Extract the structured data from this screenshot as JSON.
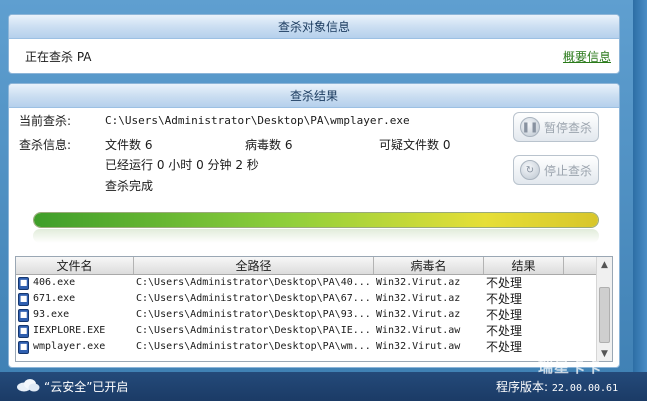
{
  "panel1": {
    "title": "查杀对象信息",
    "status_text": "正在查杀 PA",
    "summary_link": "概要信息"
  },
  "panel2": {
    "title": "查杀结果",
    "current_scan_label": "当前查杀:",
    "current_scan_value": "C:\\Users\\Administrator\\Desktop\\PA\\wmplayer.exe",
    "scan_info_label": "查杀信息:",
    "file_count": "文件数 6",
    "virus_count": "病毒数 6",
    "suspicious_count": "可疑文件数 0",
    "elapsed": "已经运行 0 小时 0 分钟 2  秒",
    "done": "查杀完成",
    "pause_button": "暂停查杀",
    "stop_button": "停止查杀",
    "progress_percent": 100
  },
  "table": {
    "columns": [
      "文件名",
      "全路径",
      "病毒名",
      "结果"
    ],
    "rows": [
      {
        "name": "406.exe",
        "path": "C:\\Users\\Administrator\\Desktop\\PA\\40...",
        "virus": "Win32.Virut.az",
        "result": "不处理"
      },
      {
        "name": "671.exe",
        "path": "C:\\Users\\Administrator\\Desktop\\PA\\67...",
        "virus": "Win32.Virut.az",
        "result": "不处理"
      },
      {
        "name": "93.exe",
        "path": "C:\\Users\\Administrator\\Desktop\\PA\\93...",
        "virus": "Win32.Virut.az",
        "result": "不处理"
      },
      {
        "name": "IEXPLORE.EXE",
        "path": "C:\\Users\\Administrator\\Desktop\\PA\\IE...",
        "virus": "Win32.Virut.aw",
        "result": "不处理"
      },
      {
        "name": "wmplayer.exe",
        "path": "C:\\Users\\Administrator\\Desktop\\PA\\wm...",
        "virus": "Win32.Virut.aw",
        "result": "不处理"
      }
    ]
  },
  "statusbar": {
    "cloud_text": "“云安全”已开启",
    "version_label": "程序版本:",
    "version_value": "22.00.00.61",
    "watermark": "瑞星卡卡"
  },
  "icons": {
    "cloud": "cloud-icon",
    "file": "exe-file-icon",
    "pause": "pause-icon",
    "stop": "stop-icon"
  }
}
